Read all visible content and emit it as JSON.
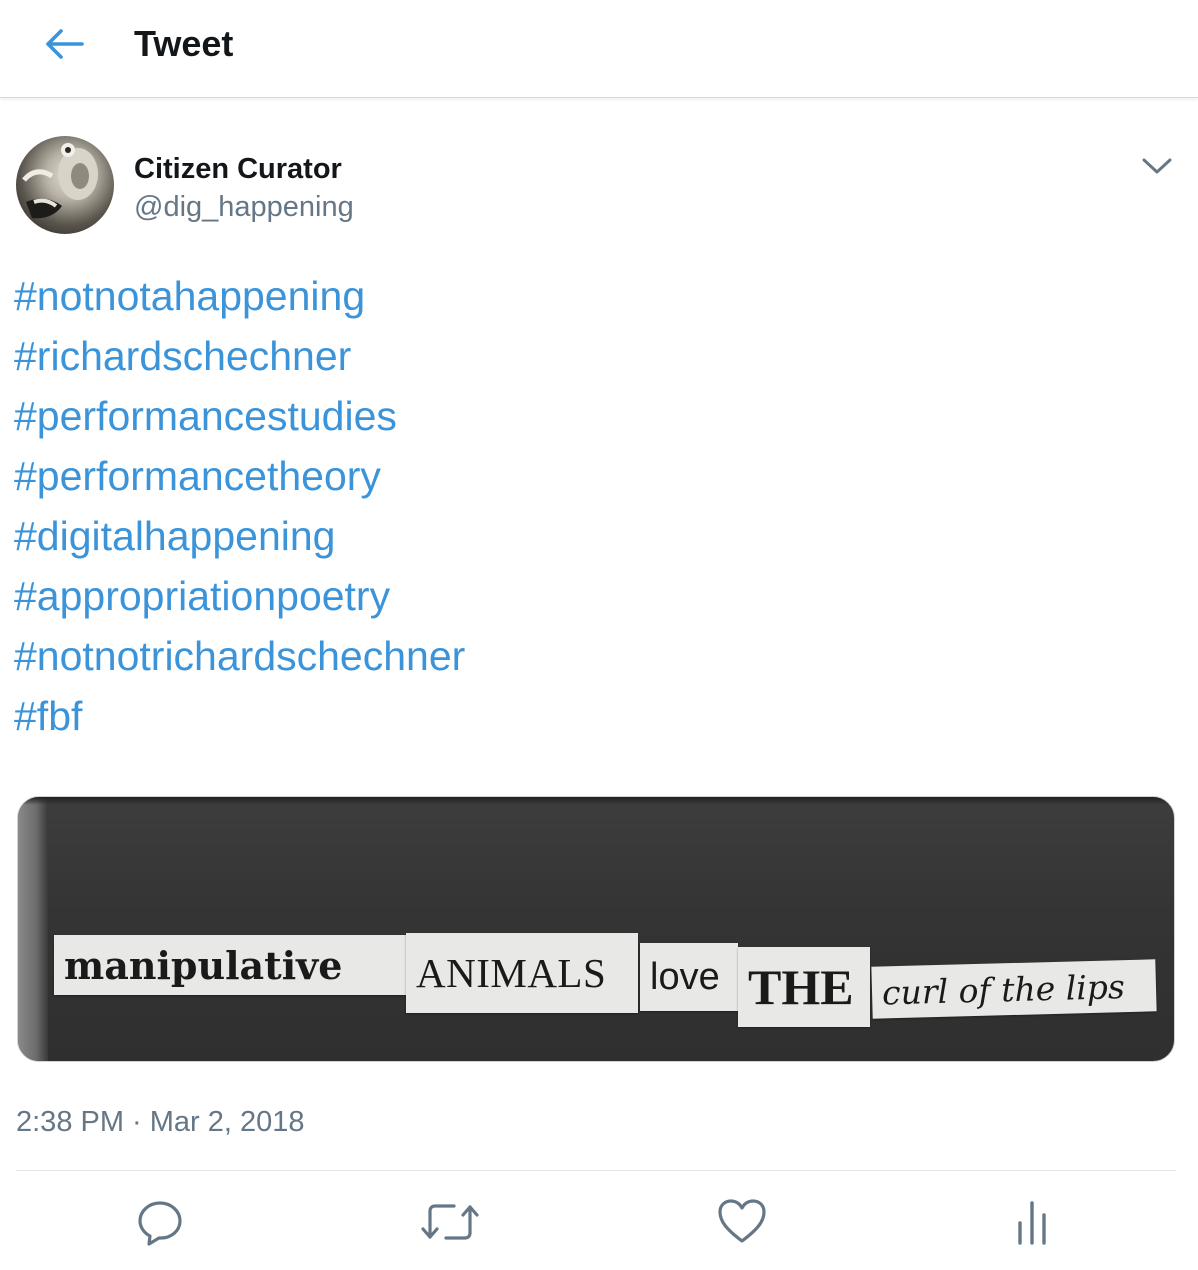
{
  "header": {
    "title": "Tweet",
    "back_icon": "arrow-left-icon",
    "accent": "#3b94d9"
  },
  "tweet": {
    "author": {
      "display_name": "Citizen Curator",
      "handle": "@dig_happening"
    },
    "hashtags": [
      "#notnotahappening",
      "#richardschechner",
      "#performancestudies",
      "#performancetheory",
      "#digitalhappening",
      "#appropriationpoetry",
      "#notnotrichardschechner",
      "#fbf"
    ],
    "media": {
      "words": [
        "manipulative",
        "ANIMALS",
        "love",
        "THE",
        "curl of the lips"
      ]
    },
    "timestamp": "2:38 PM · Mar 2, 2018"
  },
  "actions": {
    "icons": [
      "reply-icon",
      "retweet-icon",
      "like-icon",
      "analytics-icon"
    ]
  },
  "colors": {
    "link": "#3b94d9",
    "secondary_text": "#657786",
    "icon": "#657786"
  }
}
